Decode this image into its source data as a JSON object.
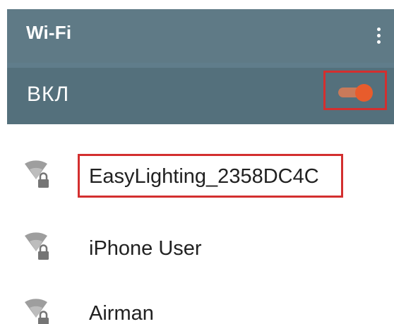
{
  "header": {
    "title": "Wi-Fi",
    "menu_icon": "more-vert-icon"
  },
  "wifi_switch": {
    "label": "ВКЛ",
    "state": "on",
    "accent_color": "#e85c2c"
  },
  "networks": [
    {
      "name": "EasyLighting_2358DC4C",
      "icon": "wifi-locked-icon",
      "highlighted": true
    },
    {
      "name": "iPhone User",
      "icon": "wifi-locked-icon",
      "highlighted": false
    },
    {
      "name": "Airman",
      "icon": "wifi-locked-icon",
      "highlighted": false
    }
  ],
  "colors": {
    "appbar": "#5f7a86",
    "switchbar": "#54707c",
    "highlight_border": "#d32f2f"
  }
}
